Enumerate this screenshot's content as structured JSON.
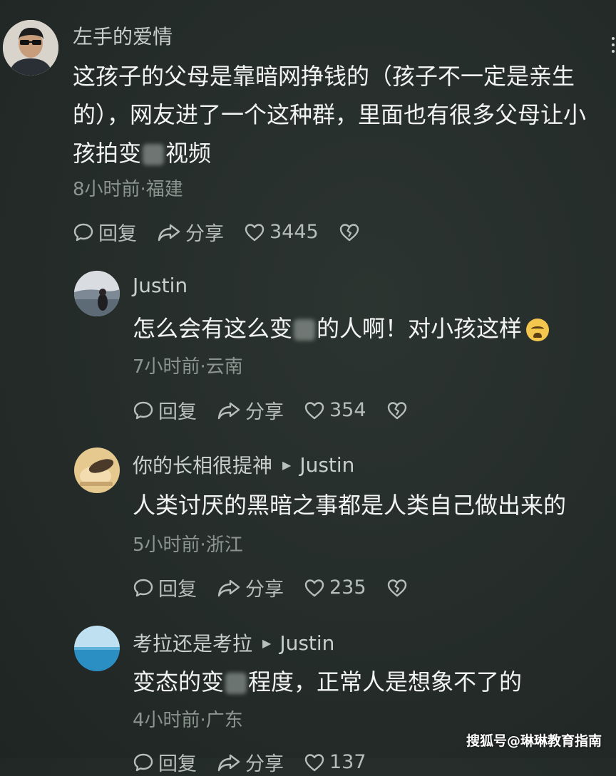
{
  "comments": [
    {
      "username": "左手的爱情",
      "lines": [
        "这孩子的父母是靠暗网挣钱的（孩子不一定是亲生",
        "的），网友进了一个这种群，里面也有很多父母让小"
      ],
      "line3_pre": "孩拍变",
      "line3_post": "视频",
      "meta": "8小时前·福建",
      "reply": "回复",
      "share": "分享",
      "likes": "3445"
    },
    {
      "username": "Justin",
      "text_pre": "怎么会有这么变",
      "text_post": "的人啊！对小孩这样",
      "meta": "7小时前·云南",
      "reply": "回复",
      "share": "分享",
      "likes": "354"
    },
    {
      "username": "你的长相很提神",
      "reply_to": "Justin",
      "text": "人类讨厌的黑暗之事都是人类自己做出来的",
      "meta": "5小时前·浙江",
      "reply": "回复",
      "share": "分享",
      "likes": "235"
    },
    {
      "username": "考拉还是考拉",
      "reply_to": "Justin",
      "text_pre": "变态的变",
      "text_post": "程度，正常人是想象不了的",
      "meta": "4小时前·广东",
      "reply": "回复",
      "share": "分享",
      "likes": "137"
    }
  ],
  "watermark": "搜狐号@琳琳教育指南",
  "colors": {
    "background": "#262d2b",
    "text": "#f2f4f3",
    "meta": "#8d9591",
    "username": "#c9cfcc"
  }
}
